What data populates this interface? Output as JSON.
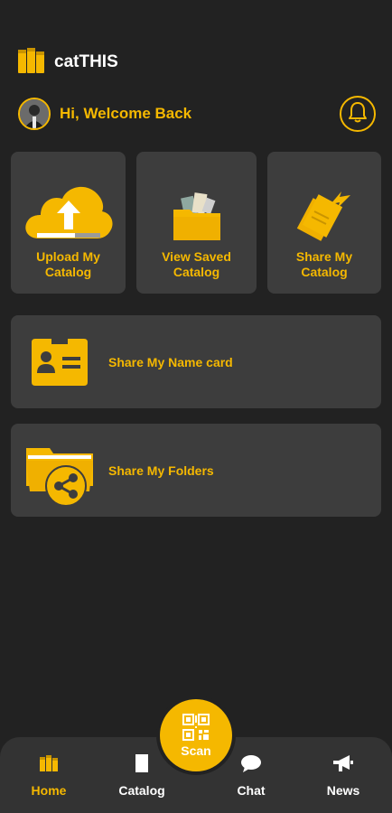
{
  "brand": {
    "title": "catTHIS"
  },
  "header": {
    "welcome": "Hi, Welcome Back"
  },
  "tiles": [
    {
      "label": "Upload My Catalog",
      "icon": "cloud-upload-icon"
    },
    {
      "label": "View Saved Catalog",
      "icon": "folder-open-icon"
    },
    {
      "label": "Share My Catalog",
      "icon": "share-documents-icon"
    }
  ],
  "actions": [
    {
      "label": "Share My Name card",
      "icon": "name-card-icon"
    },
    {
      "label": "Share My Folders",
      "icon": "share-folder-icon"
    }
  ],
  "nav": {
    "home": "Home",
    "catalog": "Catalog",
    "scan": "Scan",
    "chat": "Chat",
    "news": "News"
  },
  "colors": {
    "accent": "#f5b800",
    "background": "#222222",
    "card": "#3d3d3d",
    "nav": "#333333"
  }
}
